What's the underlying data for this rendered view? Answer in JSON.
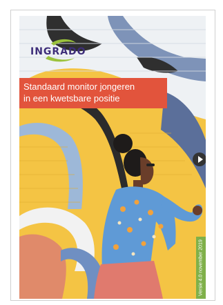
{
  "brand": {
    "logo_text": "INGRADO",
    "colors": {
      "logo_text": "#3e2e7a",
      "logo_swoosh": "#9bc23c",
      "title_background": "#e2543c",
      "date_strip_background": "#7fb04a"
    }
  },
  "cover": {
    "title_line_1": "Standaard monitor jongeren",
    "title_line_2": "in een kwetsbare positie",
    "version_text": "Versie 4.0 november 2019",
    "play_icon": "play-icon"
  }
}
